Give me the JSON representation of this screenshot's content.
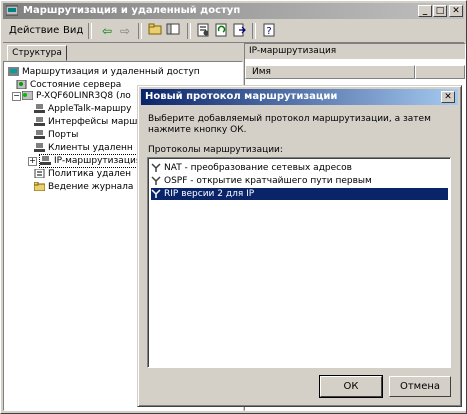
{
  "window": {
    "title": "Маршрутизация и удаленный доступ"
  },
  "menu": {
    "action": "Действие",
    "view": "Вид"
  },
  "toolbar": {
    "icons": [
      "back-arrow-icon",
      "forward-arrow-icon",
      "up-folder-icon",
      "tree-toggle-icon",
      "properties-icon",
      "refresh-icon",
      "export-icon",
      "help-icon"
    ]
  },
  "left": {
    "tab": "Структура",
    "tree": [
      {
        "label": "Маршрутизация и удаленный доступ"
      },
      {
        "label": "Состояние сервера"
      },
      {
        "label": "P-XQF60LINR3Q8 (ло"
      },
      {
        "label": "AppleTalk-маршру"
      },
      {
        "label": "Интерфейсы маршру"
      },
      {
        "label": "Порты"
      },
      {
        "label": "Клиенты удаленн"
      },
      {
        "label": "IP-маршрутизация"
      },
      {
        "label": "Политика удален"
      },
      {
        "label": "Ведение журнала"
      }
    ]
  },
  "right": {
    "header": "IP-маршрутизация",
    "column": "Имя"
  },
  "dialog": {
    "title": "Новый протокол маршрутизации",
    "instruction": "Выберите добавляемый протокол маршрутизации, а затем нажмите кнопку ОК.",
    "list_label": "Протоколы маршрутизации:",
    "protocols": [
      {
        "label": "NAT - преобразование сетевых адресов"
      },
      {
        "label": "OSPF - открытие кратчайшего пути первым"
      },
      {
        "label": "RIP версии 2 для IP"
      }
    ],
    "selected_index": 2,
    "ok_label": "ОК",
    "cancel_label": "Отмена"
  },
  "colors": {
    "selection": "#0a246a",
    "face": "#d4d0c8"
  }
}
